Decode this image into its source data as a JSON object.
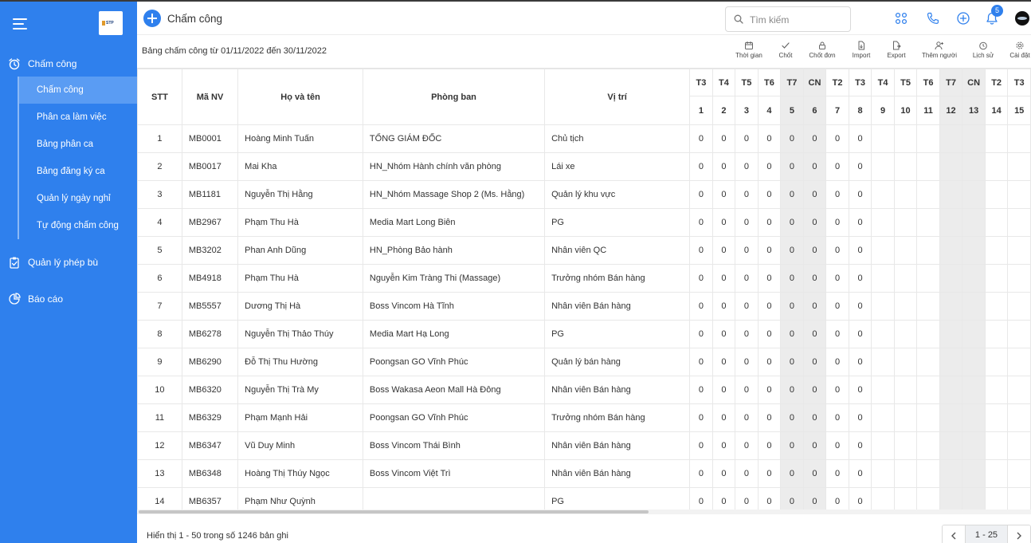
{
  "sidebar": {
    "logo_text": "STP",
    "groups": [
      {
        "label": "Chấm công"
      },
      {
        "label": "Quản lý phép bù"
      },
      {
        "label": "Báo cáo"
      }
    ],
    "items": [
      {
        "label": "Chấm công"
      },
      {
        "label": "Phân ca làm việc"
      },
      {
        "label": "Bảng phân ca"
      },
      {
        "label": "Bảng đăng ký ca"
      },
      {
        "label": "Quản lý ngày nghỉ"
      },
      {
        "label": "Tự động chấm công"
      }
    ]
  },
  "header": {
    "title": "Chấm công",
    "search_placeholder": "Tìm kiếm",
    "notification_count": "5"
  },
  "toolbar": {
    "range_label": "Bảng chấm công từ 01/11/2022 đến 30/11/2022",
    "tools": [
      "Thời gian",
      "Chốt",
      "Chốt đơn",
      "Import",
      "Export",
      "Thêm người",
      "Lịch sử",
      "Cài đặt"
    ]
  },
  "table": {
    "headers": {
      "stt": "STT",
      "code": "Mã NV",
      "name": "Họ và tên",
      "dept": "Phòng ban",
      "pos": "Vị trí"
    },
    "day_names": [
      "T3",
      "T4",
      "T5",
      "T6",
      "T7",
      "CN",
      "T2",
      "T3",
      "T4",
      "T5",
      "T6",
      "T7",
      "CN",
      "T2",
      "T3"
    ],
    "day_numbers": [
      "1",
      "2",
      "3",
      "4",
      "5",
      "6",
      "7",
      "8",
      "9",
      "10",
      "11",
      "12",
      "13",
      "14",
      "15"
    ],
    "weekend_columns": [
      4,
      5,
      11,
      12
    ],
    "rows": [
      {
        "stt": "1",
        "code": "MB0001",
        "name": "Hoàng Minh Tuấn",
        "dept": "TỔNG GIÁM ĐỐC",
        "pos": "Chủ tịch",
        "days": [
          "0",
          "0",
          "0",
          "0",
          "0",
          "0",
          "0",
          "0"
        ]
      },
      {
        "stt": "2",
        "code": "MB0017",
        "name": "Mai Kha",
        "dept": "HN_Nhóm Hành chính văn phòng",
        "pos": "Lái xe",
        "days": [
          "0",
          "0",
          "0",
          "0",
          "0",
          "0",
          "0",
          "0"
        ]
      },
      {
        "stt": "3",
        "code": "MB1181",
        "name": "Nguyễn Thị Hằng",
        "dept": "HN_Nhóm Massage Shop 2 (Ms. Hằng)",
        "pos": "Quản lý khu vực",
        "days": [
          "0",
          "0",
          "0",
          "0",
          "0",
          "0",
          "0",
          "0"
        ]
      },
      {
        "stt": "4",
        "code": "MB2967",
        "name": "Phạm Thu Hà",
        "dept": "Media Mart Long Biên",
        "pos": "PG",
        "days": [
          "0",
          "0",
          "0",
          "0",
          "0",
          "0",
          "0",
          "0"
        ]
      },
      {
        "stt": "5",
        "code": "MB3202",
        "name": "Phan Anh Dũng",
        "dept": "HN_Phòng Bảo hành",
        "pos": "Nhân viên QC",
        "days": [
          "0",
          "0",
          "0",
          "0",
          "0",
          "0",
          "0",
          "0"
        ]
      },
      {
        "stt": "6",
        "code": "MB4918",
        "name": "Phạm Thu Hà",
        "dept": "Nguyễn Kim Tràng Thi (Massage)",
        "pos": "Trưởng nhóm Bán hàng",
        "days": [
          "0",
          "0",
          "0",
          "0",
          "0",
          "0",
          "0",
          "0"
        ]
      },
      {
        "stt": "7",
        "code": "MB5557",
        "name": "Dương Thị Hà",
        "dept": "Boss Vincom Hà Tĩnh",
        "pos": "Nhân viên Bán hàng",
        "days": [
          "0",
          "0",
          "0",
          "0",
          "0",
          "0",
          "0",
          "0"
        ]
      },
      {
        "stt": "8",
        "code": "MB6278",
        "name": "Nguyễn Thị Thảo Thúy",
        "dept": "Media Mart Hạ Long",
        "pos": "PG",
        "days": [
          "0",
          "0",
          "0",
          "0",
          "0",
          "0",
          "0",
          "0"
        ]
      },
      {
        "stt": "9",
        "code": "MB6290",
        "name": "Đỗ Thị Thu Hường",
        "dept": "Poongsan GO Vĩnh Phúc",
        "pos": "Quản lý bán hàng",
        "days": [
          "0",
          "0",
          "0",
          "0",
          "0",
          "0",
          "0",
          "0"
        ]
      },
      {
        "stt": "10",
        "code": "MB6320",
        "name": "Nguyễn Thị Trà My",
        "dept": "Boss Wakasa Aeon Mall Hà Đông",
        "pos": "Nhân viên Bán hàng",
        "days": [
          "0",
          "0",
          "0",
          "0",
          "0",
          "0",
          "0",
          "0"
        ]
      },
      {
        "stt": "11",
        "code": "MB6329",
        "name": "Phạm Mạnh Hải",
        "dept": "Poongsan GO Vĩnh Phúc",
        "pos": "Trưởng nhóm Bán hàng",
        "days": [
          "0",
          "0",
          "0",
          "0",
          "0",
          "0",
          "0",
          "0"
        ]
      },
      {
        "stt": "12",
        "code": "MB6347",
        "name": "Vũ Duy Minh",
        "dept": "Boss Vincom Thái Bình",
        "pos": "Nhân viên Bán hàng",
        "days": [
          "0",
          "0",
          "0",
          "0",
          "0",
          "0",
          "0",
          "0"
        ]
      },
      {
        "stt": "13",
        "code": "MB6348",
        "name": "Hoàng Thị Thúy Ngọc",
        "dept": "Boss Vincom Việt Trì",
        "pos": "Nhân viên Bán hàng",
        "days": [
          "0",
          "0",
          "0",
          "0",
          "0",
          "0",
          "0",
          "0"
        ]
      },
      {
        "stt": "14",
        "code": "MB6357",
        "name": "Phạm Như Quỳnh",
        "dept": "",
        "pos": "PG",
        "days": [
          "0",
          "0",
          "0",
          "0",
          "0",
          "0",
          "0",
          "0"
        ]
      }
    ]
  },
  "footer": {
    "info": "Hiển thị 1 - 50 trong số 1246 bản ghi",
    "page_range": "1 - 25"
  },
  "colors": {
    "sidebar_bg": "#2f80ed",
    "sidebar_active": "#5a9cf3",
    "weekend_bg": "#ececec",
    "accent": "#2f80ed"
  }
}
